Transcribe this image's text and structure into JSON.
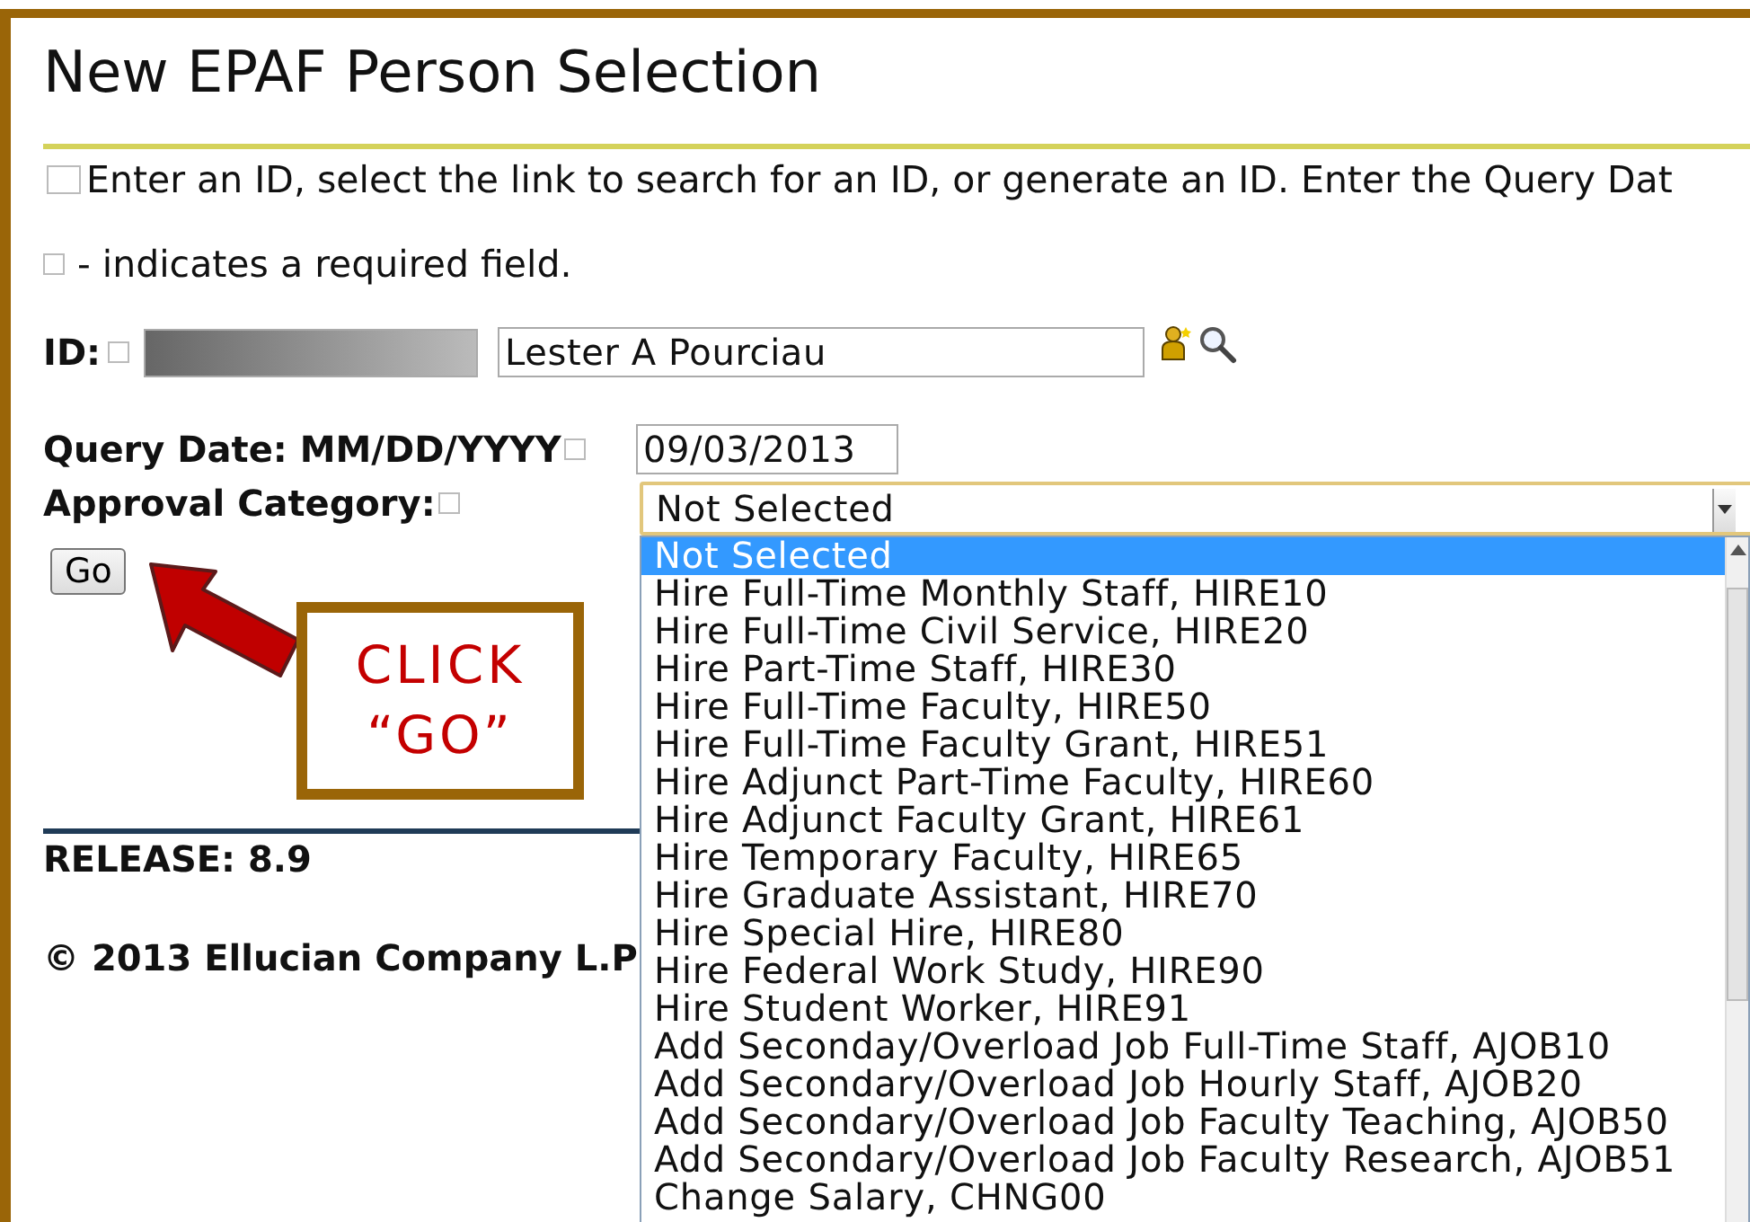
{
  "page": {
    "title": "New EPAF Person Selection",
    "instruction": "Enter an ID, select the link to search for an ID, or generate an ID. Enter the Query Dat",
    "required_note": "- indicates a required field."
  },
  "form": {
    "id_label": "ID:",
    "name_value": "Lester A Pourciau",
    "query_date_label": "Query Date: MM/DD/YYYY",
    "query_date_value": "09/03/2013",
    "approval_label": "Approval Category:",
    "approval_value": "Not Selected",
    "go_button": "Go"
  },
  "dropdown": {
    "expanded": true,
    "options": [
      {
        "label": "Not Selected",
        "selected": true
      },
      {
        "label": "Hire Full-Time Monthly Staff, HIRE10",
        "selected": false
      },
      {
        "label": "Hire Full-Time Civil Service, HIRE20",
        "selected": false
      },
      {
        "label": "Hire Part-Time Staff, HIRE30",
        "selected": false
      },
      {
        "label": "Hire Full-Time Faculty, HIRE50",
        "selected": false
      },
      {
        "label": "Hire Full-Time Faculty Grant, HIRE51",
        "selected": false
      },
      {
        "label": "Hire Adjunct Part-Time Faculty, HIRE60",
        "selected": false
      },
      {
        "label": "Hire Adjunct Faculty Grant, HIRE61",
        "selected": false
      },
      {
        "label": "Hire Temporary Faculty, HIRE65",
        "selected": false
      },
      {
        "label": "Hire Graduate Assistant, HIRE70",
        "selected": false
      },
      {
        "label": "Hire Special Hire, HIRE80",
        "selected": false
      },
      {
        "label": "Hire Federal Work Study, HIRE90",
        "selected": false
      },
      {
        "label": "Hire Student Worker, HIRE91",
        "selected": false
      },
      {
        "label": "Add Seconday/Overload Job Full-Time Staff, AJOB10",
        "selected": false
      },
      {
        "label": "Add Secondary/Overload Job Hourly Staff, AJOB20",
        "selected": false
      },
      {
        "label": "Add Secondary/Overload Job Faculty Teaching, AJOB50",
        "selected": false
      },
      {
        "label": "Add Secondary/Overload Job Faculty Research, AJOB51",
        "selected": false
      },
      {
        "label": "Change Salary, CHNG00",
        "selected": false
      }
    ]
  },
  "footer": {
    "release": "RELEASE: 8.9",
    "copyright": "© 2013 Ellucian Company L.P"
  },
  "callout": {
    "lines": [
      "CLICK",
      "“GO”"
    ]
  }
}
